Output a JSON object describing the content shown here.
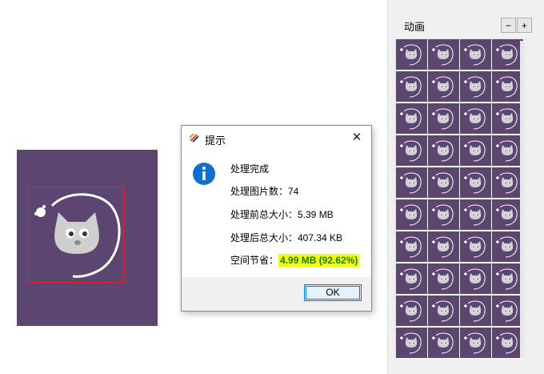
{
  "preview": {
    "background": "#5c4570",
    "selection_color": "#e0262b",
    "image": "cat-mascot"
  },
  "panel": {
    "title": "动画",
    "minus_label": "−",
    "plus_label": "+",
    "frame_count_visible": 40
  },
  "dialog": {
    "title": "提示",
    "close_label": "✕",
    "lines": {
      "status": "处理完成",
      "count": "处理图片数：74",
      "before": "处理前总大小：5.39 MB",
      "after": "处理后总大小：407.34 KB",
      "saved_label": "空间节省：",
      "saved_value": "4.99 MB (92.62%)"
    },
    "ok_label": "OK",
    "icons": {
      "app": "app-logo-icon",
      "info": "info-icon"
    }
  },
  "colors": {
    "highlight_bg": "#f3ff00",
    "highlight_text": "#1f7a1f",
    "info_blue": "#0d6fcf"
  }
}
